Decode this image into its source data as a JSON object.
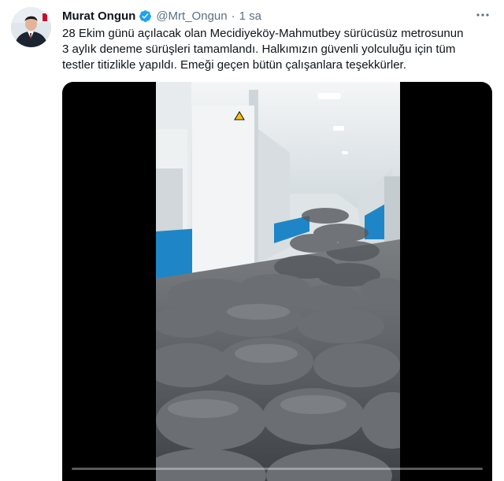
{
  "tweet": {
    "author": {
      "display_name": "Murat Ongun",
      "handle": "@Mrt_Ongun",
      "verified": true,
      "avatar_icon": "profile-photo-man-in-suit"
    },
    "separator": "·",
    "timestamp": "1 sa",
    "more_icon": "more-horizontal-icon",
    "text_lines": [
      "28 Ekim günü açılacak olan Mecidiyeköy-Mahmutbey sürücüsüz metrosunun",
      "3 aylık deneme sürüşleri tamamlandı. Halkımızın güvenli yolculuğu için tüm",
      "testler titizlikle yapıldı. Emeği geçen bütün çalışanlara teşekkürler."
    ],
    "media": {
      "type": "video",
      "description_icon": "metro-car-interior-with-sandbags",
      "progress": 0.0
    }
  },
  "colors": {
    "text_primary": "#0f1419",
    "text_secondary": "#5b7083",
    "verified_blue": "#1da1f2",
    "media_background": "#000000"
  }
}
